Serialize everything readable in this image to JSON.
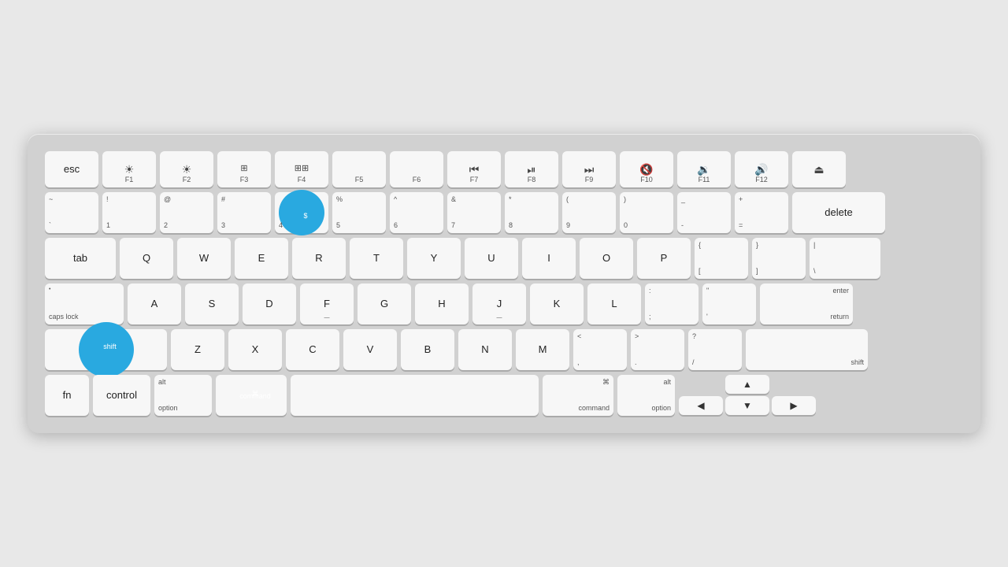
{
  "keyboard": {
    "rows": {
      "fn_row": [
        "esc",
        "F1",
        "F2",
        "F3",
        "F4",
        "F5",
        "F6",
        "F7",
        "F8",
        "F9",
        "F10",
        "F11",
        "F12",
        "eject"
      ],
      "number_row": [
        "~`",
        "!1",
        "@2",
        "#3",
        "$4",
        "%5",
        "^6",
        "&7",
        "*8",
        "(9",
        ")0",
        "-",
        "=+",
        "delete"
      ],
      "qwerty": [
        "tab",
        "Q",
        "W",
        "E",
        "R",
        "T",
        "Y",
        "U",
        "I",
        "O",
        "P",
        "{[",
        "}]",
        "|\\"
      ],
      "home": [
        "caps lock",
        "A",
        "S",
        "D",
        "F",
        "G",
        "H",
        "J",
        "K",
        "L",
        ";:",
        "'\",",
        "return"
      ],
      "shift": [
        "shift",
        "Z",
        "X",
        "C",
        "V",
        "B",
        "N",
        "M",
        "<,",
        ">.",
        "?/",
        "shift"
      ],
      "bottom": [
        "fn",
        "control",
        "option",
        "command",
        "space",
        "command",
        "option"
      ]
    },
    "highlighted": {
      "dollar_4": true,
      "shift_left": true,
      "command_left": true
    }
  },
  "background_color": "#e8e8e8",
  "keyboard_color": "#d1d1d1"
}
